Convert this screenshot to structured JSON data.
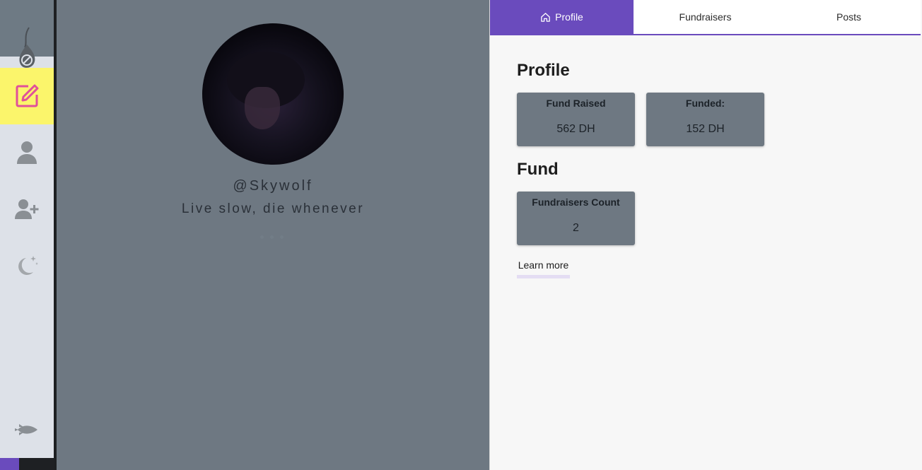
{
  "sidebar": {
    "items": [
      {
        "icon": "logo-drop-icon"
      },
      {
        "icon": "edit-icon",
        "active": true
      },
      {
        "icon": "person-icon"
      },
      {
        "icon": "person-add-icon"
      },
      {
        "icon": "moon-stars-icon"
      },
      {
        "icon": "rocket-icon"
      }
    ]
  },
  "profile": {
    "username": "@Skywolf",
    "bio": "Live slow, die whenever"
  },
  "tabs": [
    {
      "label": "Profile",
      "icon": "home-icon",
      "active": true
    },
    {
      "label": "Fundraisers",
      "active": false
    },
    {
      "label": "Posts",
      "active": false
    }
  ],
  "main": {
    "profile_title": "Profile",
    "fund_title": "Fund",
    "cards": {
      "fund_raised": {
        "label": "Fund Raised",
        "value": "562 DH"
      },
      "funded": {
        "label": "Funded:",
        "value": "152 DH"
      },
      "fundraisers_count": {
        "label": "Fundraisers Count",
        "value": "2"
      }
    },
    "learn_more": "Learn more"
  },
  "colors": {
    "accent": "#6a4bbd",
    "panel": "#6e7882",
    "active_nav": "#fbf56b",
    "edit_icon": "#e0509a"
  }
}
